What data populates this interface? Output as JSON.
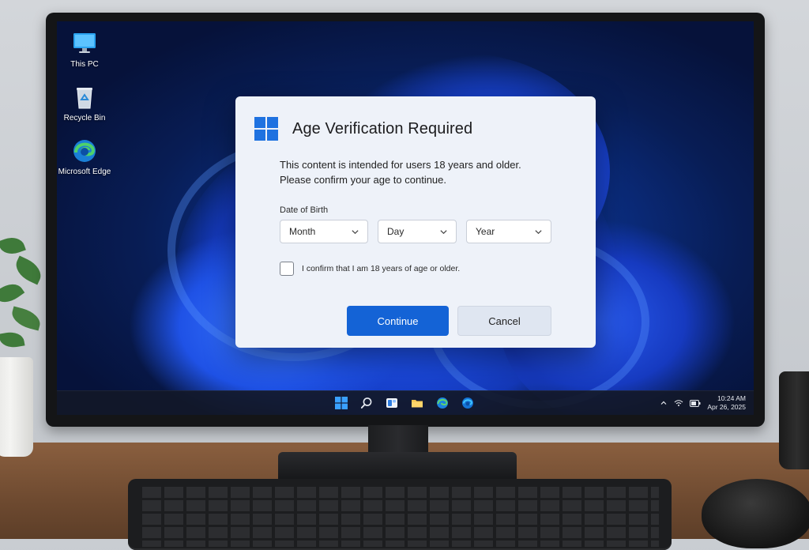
{
  "desktop": {
    "icons": [
      {
        "label": "This PC"
      },
      {
        "label": "Recycle Bin"
      },
      {
        "label": "Microsoft Edge"
      }
    ]
  },
  "dialog": {
    "title": "Age Verification Required",
    "message_line1": "This content is intended for users 18 years and older.",
    "message_line2": "Please confirm your age to continue.",
    "dob_label": "Date of Birth",
    "month_placeholder": "Month",
    "day_placeholder": "Day",
    "year_placeholder": "Year",
    "confirm_label": "I confirm that I am 18 years of age or older.",
    "confirm_checked": false,
    "continue_label": "Continue",
    "cancel_label": "Cancel",
    "accent_color": "#1463d6"
  },
  "taskbar": {
    "items": [
      "windows-start-icon",
      "search-icon",
      "widgets-icon",
      "file-explorer-icon",
      "edge-icon",
      "edge-icon"
    ],
    "time": "10:24 AM",
    "date": "Apr 26, 2025"
  }
}
